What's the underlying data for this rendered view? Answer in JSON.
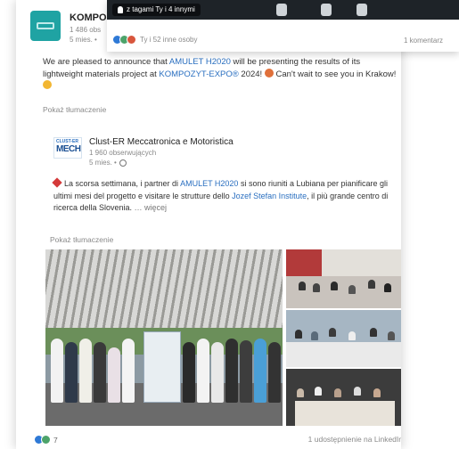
{
  "post": {
    "author": "KOMPO",
    "followers": "1 486 obs",
    "time": "5 mies. •",
    "text_before": "We are pleased to announce that ",
    "project": "AMULET H2020",
    "text_middle": " will be presenting the results of its lightweight materials project at ",
    "expo": "KOMPOZYT-EXPO®",
    "text_after": " 2024! ",
    "text_end": " Can't wait to see you in Krakow! ",
    "see_translation": "Pokaż tłumaczenie"
  },
  "shared": {
    "logo_small": "CLUST-ER",
    "logo_big": "MECH",
    "author": "Clust-ER Meccatronica e Motoristica",
    "followers": "1 960 obserwujących",
    "time": "5 mies. •",
    "text_1": "La scorsa settimana, i partner di ",
    "project": "AMULET H2020",
    "text_2": " si sono riuniti a Lubiana per pianificare gli ultimi mesi del progetto e visitare le strutture dello ",
    "institute": "Jozef Stefan Institute",
    "text_3": ", il più grande centro di ricerca della Slovenia.",
    "more": " … więcej",
    "see_translation": "Pokaż tłumaczenie"
  },
  "footer": {
    "reactions_count": "7",
    "shares": "1 udostępnienie na LinkedIn"
  },
  "overlay": {
    "tag": "z tagami Ty i 4 innymi",
    "reactions": "Ty i 52 inne osoby",
    "comments": "1 komentarz"
  },
  "colors": {
    "accent": "#2a6fc0",
    "kompo_brand": "#1fa3a3",
    "like": "#2e79d6",
    "celebrate": "#4ca36a"
  },
  "icons": [
    "globe-icon",
    "pin-icon",
    "user-tag-icon",
    "like-reaction-icon",
    "celebrate-reaction-icon"
  ]
}
